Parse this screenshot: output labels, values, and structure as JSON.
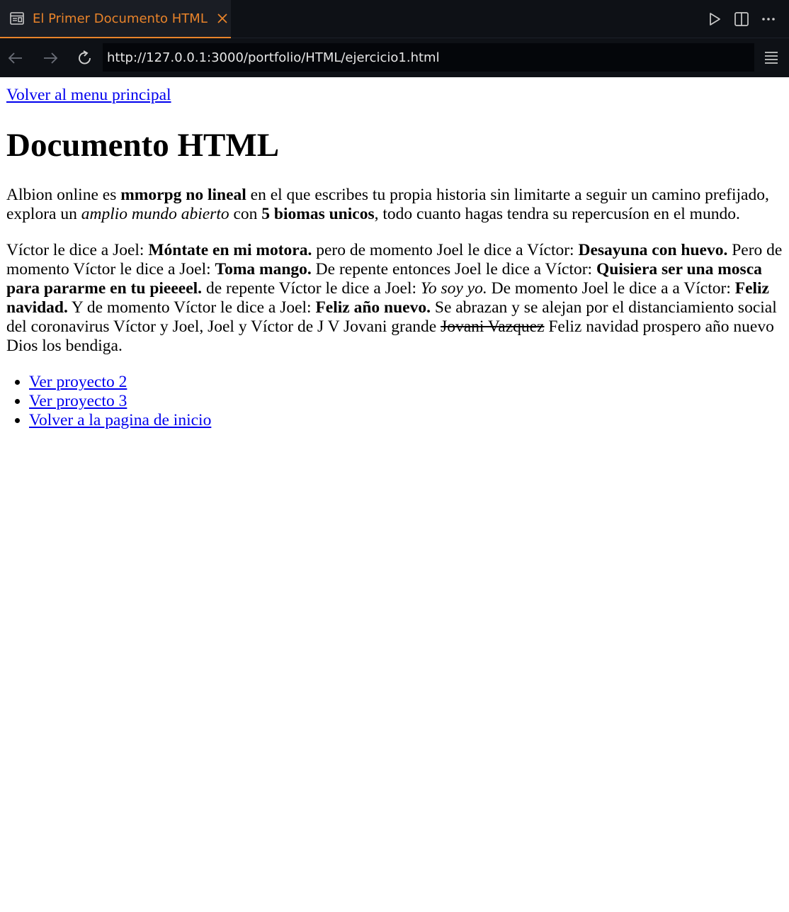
{
  "tab": {
    "title": "El Primer Documento HTML",
    "icon": "preview-icon",
    "close_icon": "close-icon"
  },
  "toolbar": {
    "actions": [
      "run-icon",
      "split-editor-icon",
      "more-icon"
    ]
  },
  "address_bar": {
    "back_icon": "arrow-left-icon",
    "forward_icon": "arrow-right-icon",
    "reload_icon": "reload-icon",
    "url": "http://127.0.0.1:3000/portfolio/HTML/ejercicio1.html",
    "menu_icon": "menu-icon"
  },
  "page": {
    "back_link": "Volver al menu principal",
    "heading": "Documento HTML",
    "p1": {
      "t1": "Albion online es ",
      "b1": "mmorpg no lineal",
      "t2": " en el que escribes tu propia historia sin limitarte a seguir un camino prefijado, explora un ",
      "i1": "amplio mundo abierto",
      "t3": " con ",
      "b2": "5 biomas unicos",
      "t4": ", todo cuanto hagas tendra su repercusíon en el mundo."
    },
    "p2": {
      "t1": "Víctor le dice a Joel: ",
      "b1": "Móntate en mi motora.",
      "t2": " pero de momento Joel le dice a Víctor: ",
      "b2": "Desayuna con huevo.",
      "t3": " Pero de momento Víctor le dice a Joel: ",
      "b3": "Toma mango.",
      "t4": " De repente entonces Joel le dice a Víctor: ",
      "b4": "Quisiera ser una mosca para pararme en tu pieeeel.",
      "t5": " de repente Víctor le dice a Joel: ",
      "i1": "Yo soy yo.",
      "t6": " De momento Joel le dice a a Víctor: ",
      "b5": "Feliz navidad.",
      "t7": " Y de momento Víctor le dice a Joel: ",
      "b6": "Feliz año nuevo.",
      "t8": " Se abrazan y se alejan por el distanciamiento social del coronavirus Víctor y Joel, Joel y Víctor de J V Jovani grande ",
      "s1": "Jovani Vazquez",
      "t9": " Feliz navidad prospero año nuevo Dios los bendiga."
    },
    "links": [
      "Ver proyecto 2",
      "Ver proyecto 3",
      "Volver a la pagina de inicio"
    ]
  },
  "colors": {
    "chrome_bg": "#0e1116",
    "tab_bg": "#1a1d24",
    "accent": "#e8832a",
    "link": "#0000ee"
  }
}
